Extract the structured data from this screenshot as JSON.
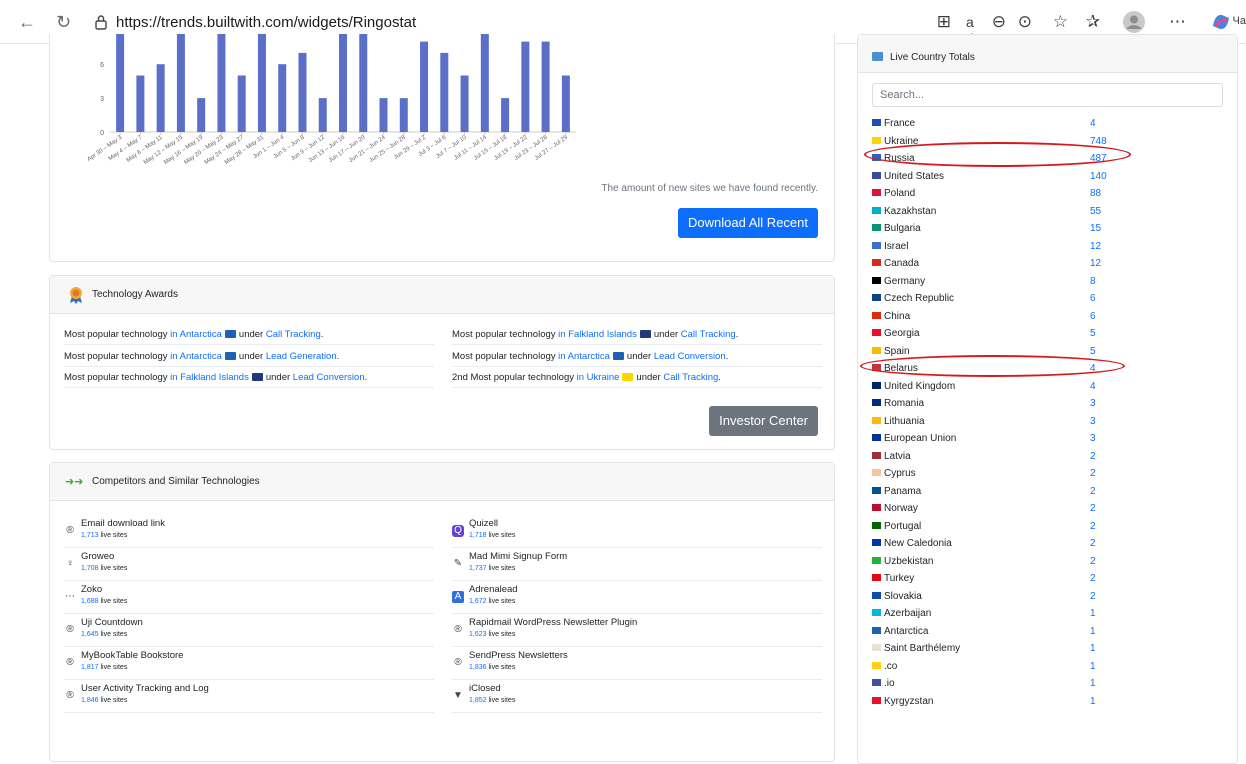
{
  "browser": {
    "url": "https://trends.builtwith.com/widgets/Ringostat",
    "profile_label": "Ча"
  },
  "chart_data": {
    "type": "bar",
    "categories": [
      "Apr 30 – May 3",
      "May 4 – May 7",
      "May 8 – May 11",
      "May 12 – May 15",
      "May 16 – May 19",
      "May 20 – May 23",
      "May 24 – May 27",
      "May 28 – May 31",
      "Jun 1 – Jun 4",
      "Jun 5 – Jun 8",
      "Jun 9 – Jun 12",
      "Jun 13 – Jun 16",
      "Jun 17 – Jun 20",
      "Jun 21 – Jun 24",
      "Jun 25 – Jun 28",
      "Jun 29 – Jul 2",
      "Jul 3 – Jul 6",
      "Jul 7 – Jul 10",
      "Jul 11 – Jul 14",
      "Jul 15 – Jul 18",
      "Jul 19 – Jul 22",
      "Jul 23 – Jul 26",
      "Jul 27 – Jul 29"
    ],
    "values": [
      9,
      5,
      6,
      9,
      3,
      9,
      5,
      9,
      6,
      7,
      3,
      9,
      9,
      3,
      3,
      8,
      7,
      5,
      9,
      3,
      8,
      8,
      5
    ],
    "yticks": [
      0,
      3,
      6
    ],
    "ylim": [
      0,
      9
    ],
    "color": "#5b6fc9",
    "caption": "The amount of new sites we have found recently.",
    "download_label": "Download All Recent"
  },
  "awards": {
    "title": "Technology Awards",
    "left": [
      {
        "prefix": "Most popular technology ",
        "place": "in Antarctica",
        "flag": "#1f5fb4",
        "mid": " under ",
        "cat": "Call Tracking",
        "end": "."
      },
      {
        "prefix": "Most popular technology ",
        "place": "in Antarctica",
        "flag": "#1f5fb4",
        "mid": " under ",
        "cat": "Lead Generation",
        "end": "."
      },
      {
        "prefix": "Most popular technology ",
        "place": "in Falkland Islands",
        "flag": "#1f3a7a",
        "mid": " under ",
        "cat": "Lead Conversion",
        "end": "."
      }
    ],
    "right": [
      {
        "prefix": "Most popular technology ",
        "place": "in Falkland Islands",
        "flag": "#1f3a7a",
        "mid": " under ",
        "cat": "Call Tracking",
        "end": "."
      },
      {
        "prefix": "Most popular technology ",
        "place": "in Antarctica",
        "flag": "#1f5fb4",
        "mid": " under ",
        "cat": "Lead Conversion",
        "end": "."
      },
      {
        "prefix": "2nd Most popular technology ",
        "place": "in Ukraine",
        "flag": "#ffd500",
        "mid": " under ",
        "cat": "Call Tracking",
        "end": "."
      }
    ],
    "investor_label": "Investor Center"
  },
  "competitors": {
    "title": "Competitors and Similar Technologies",
    "left": [
      {
        "name": "Email download link",
        "sites": "1,713",
        "icon": "wordpress-icon",
        "glyph": "®"
      },
      {
        "name": "Groweo",
        "sites": "1,708",
        "icon": "groweo-icon",
        "glyph": "♀"
      },
      {
        "name": "Zoko",
        "sites": "1,688",
        "icon": "zoko-icon",
        "glyph": "⋯"
      },
      {
        "name": "Uji Countdown",
        "sites": "1,645",
        "icon": "wordpress-icon",
        "glyph": "®"
      },
      {
        "name": "MyBookTable Bookstore",
        "sites": "1,817",
        "icon": "wordpress-icon",
        "glyph": "®"
      },
      {
        "name": "User Activity Tracking and Log",
        "sites": "1,846",
        "icon": "wordpress-icon",
        "glyph": "®"
      }
    ],
    "right": [
      {
        "name": "Quizell",
        "sites": "1,718",
        "icon": "quizell-icon",
        "glyph": "Q"
      },
      {
        "name": "Mad Mimi Signup Form",
        "sites": "1,737",
        "icon": "mad-mimi-icon",
        "glyph": "✎"
      },
      {
        "name": "Adrenalead",
        "sites": "1,672",
        "icon": "adrenalead-icon",
        "glyph": "A"
      },
      {
        "name": "Rapidmail WordPress Newsletter Plugin",
        "sites": "1,623",
        "icon": "wordpress-icon",
        "glyph": "®"
      },
      {
        "name": "SendPress Newsletters",
        "sites": "1,836",
        "icon": "wordpress-icon",
        "glyph": "®"
      },
      {
        "name": "iClosed",
        "sites": "1,852",
        "icon": "iclosed-icon",
        "glyph": "▼"
      }
    ],
    "sites_suffix": " live sites"
  },
  "sidebar": {
    "title": "Live Country Totals",
    "search_placeholder": "Search...",
    "countries": [
      {
        "name": "France",
        "count": "4",
        "flag": "#1f4fb4"
      },
      {
        "name": "Ukraine",
        "count": "748",
        "flag": "#ffd500"
      },
      {
        "name": "Russia",
        "count": "487",
        "flag": "#2f5fbf"
      },
      {
        "name": "United States",
        "count": "140",
        "flag": "#3c4a9e"
      },
      {
        "name": "Poland",
        "count": "88",
        "flag": "#dc143c"
      },
      {
        "name": "Kazakhstan",
        "count": "55",
        "flag": "#00afca"
      },
      {
        "name": "Bulgaria",
        "count": "15",
        "flag": "#00966e"
      },
      {
        "name": "Israel",
        "count": "12",
        "flag": "#3f6fc7"
      },
      {
        "name": "Canada",
        "count": "12",
        "flag": "#d52b1e"
      },
      {
        "name": "Germany",
        "count": "8",
        "flag": "#000000"
      },
      {
        "name": "Czech Republic",
        "count": "6",
        "flag": "#11457e"
      },
      {
        "name": "China",
        "count": "6",
        "flag": "#de2910"
      },
      {
        "name": "Georgia",
        "count": "5",
        "flag": "#e8112d"
      },
      {
        "name": "Spain",
        "count": "5",
        "flag": "#f1bf00"
      },
      {
        "name": "Belarus",
        "count": "4",
        "flag": "#c8313e"
      },
      {
        "name": "United Kingdom",
        "count": "4",
        "flag": "#012169"
      },
      {
        "name": "Romania",
        "count": "3",
        "flag": "#002b7f"
      },
      {
        "name": "Lithuania",
        "count": "3",
        "flag": "#fdb913"
      },
      {
        "name": "European Union",
        "count": "3",
        "flag": "#003399"
      },
      {
        "name": "Latvia",
        "count": "2",
        "flag": "#9e3039"
      },
      {
        "name": "Cyprus",
        "count": "2",
        "flag": "#f0c8a0"
      },
      {
        "name": "Panama",
        "count": "2",
        "flag": "#005293"
      },
      {
        "name": "Norway",
        "count": "2",
        "flag": "#ba0c2f"
      },
      {
        "name": "Portugal",
        "count": "2",
        "flag": "#006600"
      },
      {
        "name": "New Caledonia",
        "count": "2",
        "flag": "#0035ad"
      },
      {
        "name": "Uzbekistan",
        "count": "2",
        "flag": "#1eb53a"
      },
      {
        "name": "Turkey",
        "count": "2",
        "flag": "#e30a17"
      },
      {
        "name": "Slovakia",
        "count": "2",
        "flag": "#0b4ea2"
      },
      {
        "name": "Azerbaijan",
        "count": "1",
        "flag": "#00b5e2"
      },
      {
        "name": "Antarctica",
        "count": "1",
        "flag": "#1f5fb4"
      },
      {
        "name": "Saint Barthélemy",
        "count": "1",
        "flag": "#e8e0d0"
      },
      {
        "name": ".co",
        "count": "1",
        "flag": "#fcd116"
      },
      {
        "name": ".io",
        "count": "1",
        "flag": "#3f4fa0"
      },
      {
        "name": "Kyrgyzstan",
        "count": "1",
        "flag": "#e8112d"
      }
    ]
  },
  "colors": {
    "link": "#0d6efd",
    "annotation": "#d7191c"
  }
}
